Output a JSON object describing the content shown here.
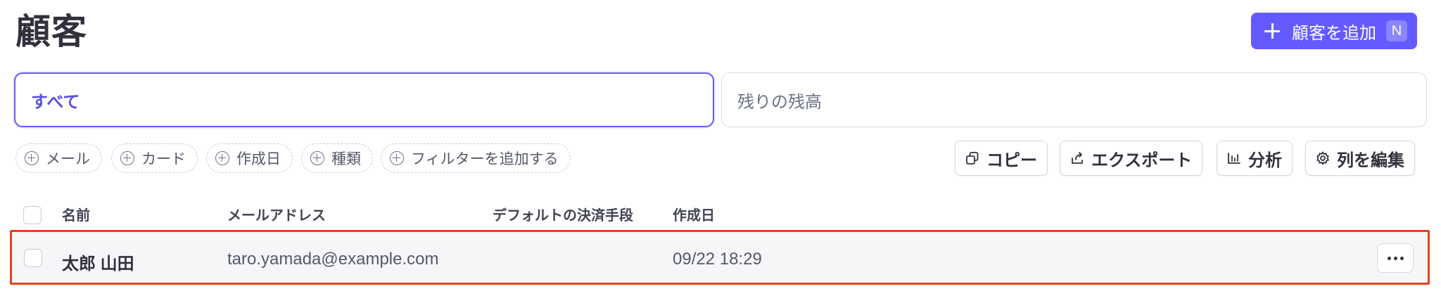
{
  "header": {
    "title": "顧客",
    "add_button_label": "顧客を追加",
    "add_button_shortcut": "N"
  },
  "segments": {
    "all_label": "すべて",
    "balance_label": "残りの残高"
  },
  "filters": [
    {
      "label": "メール"
    },
    {
      "label": "カード"
    },
    {
      "label": "作成日"
    },
    {
      "label": "種類"
    },
    {
      "label": "フィルターを追加する"
    }
  ],
  "actions": {
    "copy_label": "コピー",
    "export_label": "エクスポート",
    "analyze_label": "分析",
    "edit_columns_label": "列を編集"
  },
  "table": {
    "columns": [
      "名前",
      "メールアドレス",
      "デフォルトの決済手段",
      "作成日"
    ],
    "rows": [
      {
        "name": "太郎 山田",
        "email": "taro.yamada@example.com",
        "payment_method": "",
        "created": "09/22 18:29"
      }
    ]
  },
  "colors": {
    "accent": "#635bff",
    "highlight_border": "#e8421c"
  }
}
